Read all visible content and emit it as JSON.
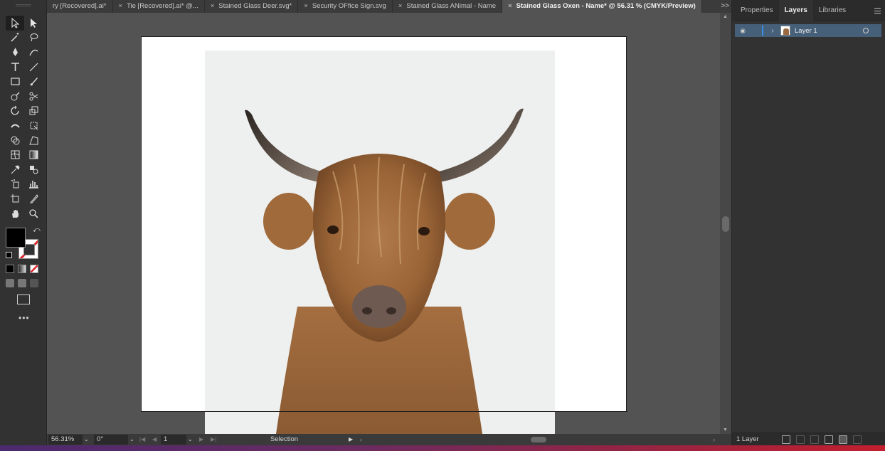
{
  "tabs": [
    {
      "label": "ry [Recovered].ai*",
      "active": false,
      "closable": false
    },
    {
      "label": "Tie [Recovered].ai* @...",
      "active": false,
      "closable": true
    },
    {
      "label": "Stained Glass Deer.svg*",
      "active": false,
      "closable": true
    },
    {
      "label": "Security OFfice Sign.svg",
      "active": false,
      "closable": true
    },
    {
      "label": "Stained Glass ANimal - Name",
      "active": false,
      "closable": true
    },
    {
      "label": "Stained Glass Oxen - Name* @ 56.31 % (CMYK/Preview)",
      "active": true,
      "closable": true
    }
  ],
  "tab_overflow": ">>",
  "close_glyph": "×",
  "panel": {
    "tabs": [
      {
        "label": "Properties",
        "active": false
      },
      {
        "label": "Layers",
        "active": true
      },
      {
        "label": "Libraries",
        "active": false
      }
    ],
    "layers": [
      {
        "name": "Layer 1",
        "visible": true,
        "selected": true
      }
    ],
    "footer_count": "1 Layer"
  },
  "status": {
    "zoom": "56.31%",
    "rotation": "0°",
    "artboard_number": "1",
    "tool_name": "Selection"
  },
  "canvas": {
    "document_mode": "CMYK/Preview",
    "image_subject": "highland-cow-photo"
  },
  "colors": {
    "fill": "#000000",
    "stroke": "none",
    "accent": "#46607a"
  }
}
